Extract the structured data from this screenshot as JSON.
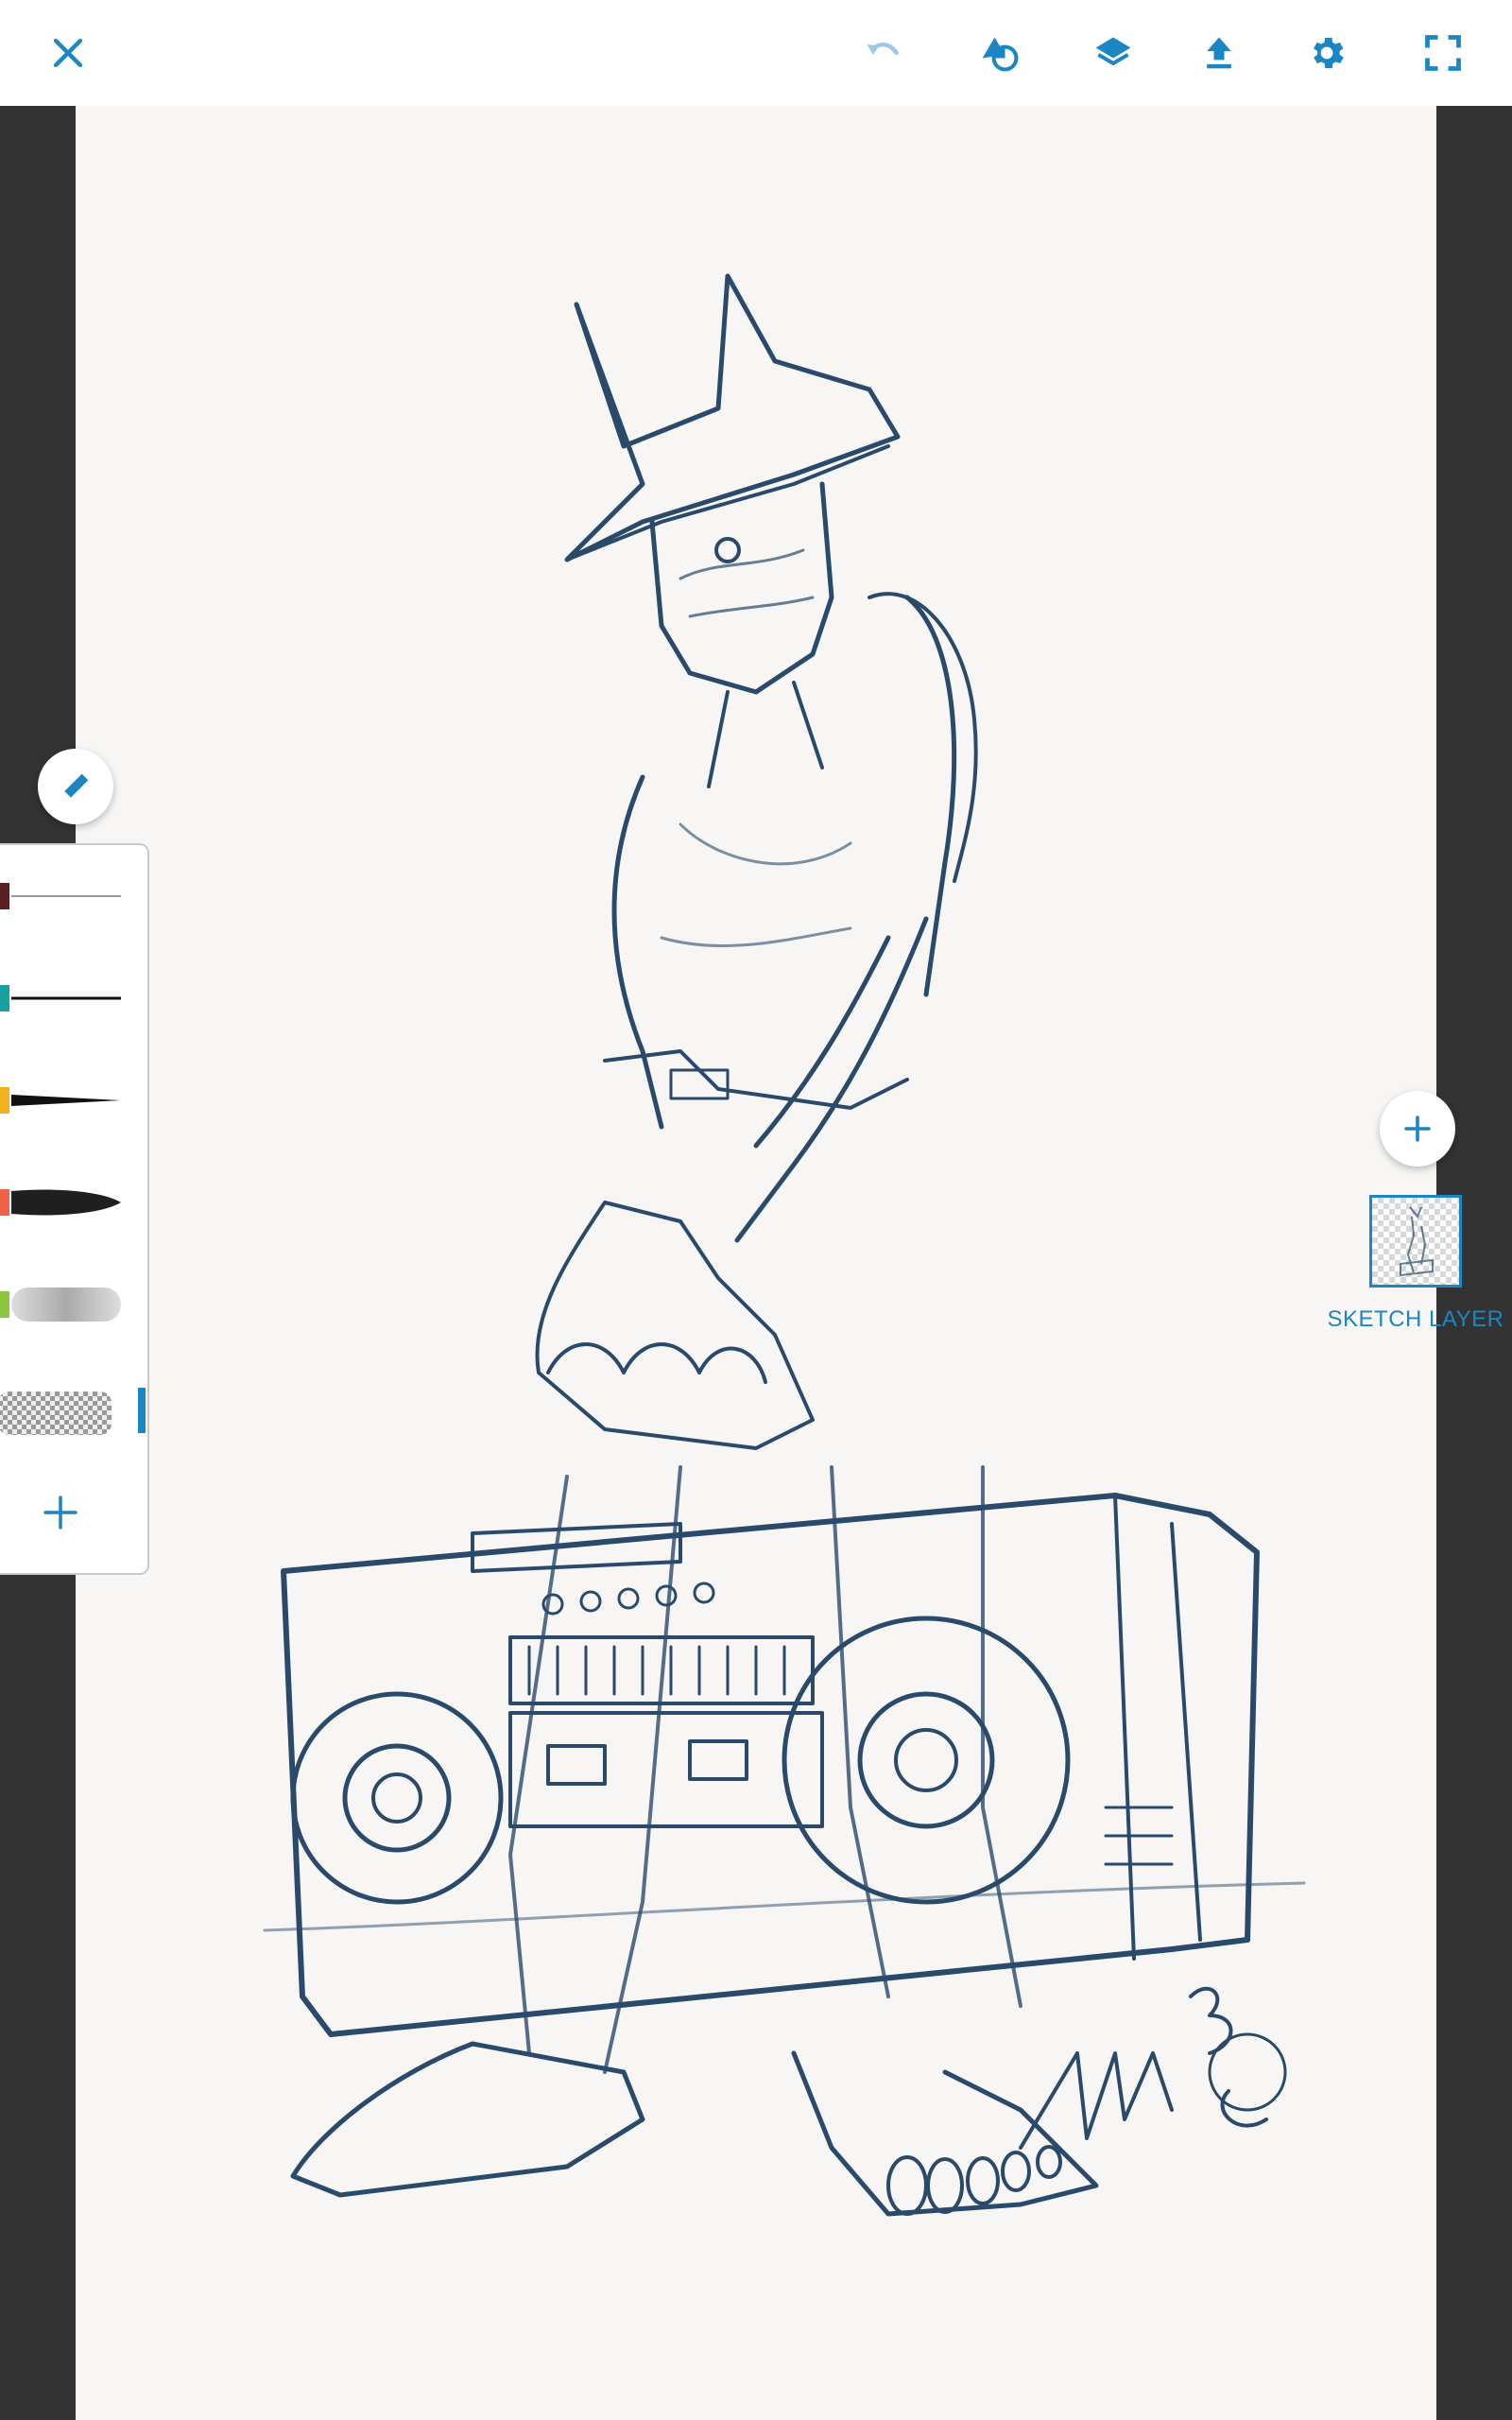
{
  "toolbar": {
    "close_icon": "close-icon",
    "undo_icon": "undo-icon",
    "shape_icon": "shape-overlay-icon",
    "layers_icon": "layers-icon",
    "export_icon": "upload-icon",
    "settings_icon": "gear-icon",
    "fullscreen_icon": "fullscreen-icon"
  },
  "brush_panel": {
    "brushes": [
      {
        "name": "fine-pencil",
        "color": "#5a1f1f"
      },
      {
        "name": "ink-pen",
        "color": "#1a9fa3"
      },
      {
        "name": "tapered-brush",
        "color": "#f1b21e"
      },
      {
        "name": "thick-marker",
        "color": "#f1614a"
      },
      {
        "name": "soft-airbrush",
        "color": "#8cc63e"
      },
      {
        "name": "eraser",
        "color": "#cccccc",
        "selected": true
      }
    ],
    "add_icon": "plus-icon"
  },
  "layers": {
    "add_icon": "plus-icon",
    "items": [
      {
        "label": "SKETCH LAYER"
      }
    ]
  },
  "colors": {
    "accent": "#1b86c4",
    "sketch": "#2a4a6b",
    "canvas": "#f7f6f4",
    "background": "#333333"
  }
}
